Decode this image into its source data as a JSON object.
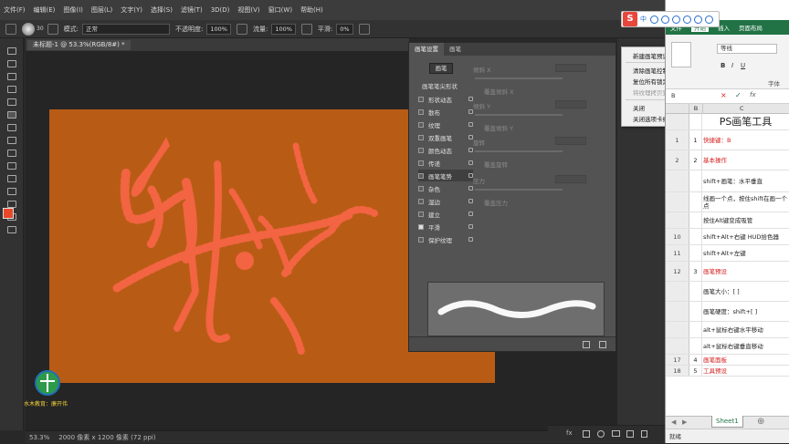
{
  "ps": {
    "menu": [
      "文件(F)",
      "编辑(E)",
      "图像(I)",
      "图层(L)",
      "文字(Y)",
      "选择(S)",
      "滤镜(T)",
      "3D(D)",
      "视图(V)",
      "窗口(W)",
      "帮助(H)"
    ],
    "options": {
      "brush_size": "30",
      "mode_label": "模式:",
      "mode_value": "正常",
      "opacity_label": "不透明度:",
      "opacity_value": "100%",
      "flow_label": "流量:",
      "flow_value": "100%",
      "smooth_label": "平滑:",
      "smooth_value": "0%"
    },
    "doc_tab": "未标题-1 @ 53.3%(RGB/8#) *",
    "status": {
      "zoom": "53.3%",
      "doc_info": "2000 像素 x 1200 像素 (72 ppi)"
    },
    "colors": {
      "canvas": "#b85c15",
      "stroke": "#f26442",
      "foreground": "#e8472a"
    }
  },
  "brush_panel": {
    "tabs": [
      "画笔设置",
      "画笔"
    ],
    "brush_button": "画笔",
    "header": "画笔笔尖形状",
    "options": [
      {
        "label": "形状动态",
        "checked": false
      },
      {
        "label": "散布",
        "checked": false
      },
      {
        "label": "纹理",
        "checked": false
      },
      {
        "label": "双重画笔",
        "checked": false
      },
      {
        "label": "颜色动态",
        "checked": false
      },
      {
        "label": "传递",
        "checked": false
      },
      {
        "label": "画笔笔势",
        "checked": false,
        "selected": true
      },
      {
        "label": "杂色",
        "checked": false
      },
      {
        "label": "湿边",
        "checked": false
      },
      {
        "label": "建立",
        "checked": false
      },
      {
        "label": "平滑",
        "checked": true
      },
      {
        "label": "保护纹理",
        "checked": false
      }
    ],
    "settings": {
      "tilt_x": "倾斜 X",
      "override_tilt_x": "覆盖倾斜 X",
      "tilt_y": "倾斜 Y",
      "override_tilt_y": "覆盖倾斜 Y",
      "rotation": "旋转",
      "override_rotation": "覆盖旋转",
      "pressure": "压力",
      "override_pressure": "覆盖压力"
    }
  },
  "context_menu": {
    "items": [
      {
        "label": "新建画笔预设...",
        "disabled": false
      },
      {
        "label": "清除画笔控制",
        "disabled": false
      },
      {
        "label": "复位所有锁定设置",
        "disabled": false
      },
      {
        "label": "将纹理拷贝到其它工具",
        "disabled": true
      },
      {
        "label": "关闭",
        "disabled": false
      },
      {
        "label": "关闭选项卡组",
        "disabled": false
      }
    ]
  },
  "ime": {
    "logo": "S",
    "lang": "中"
  },
  "excel": {
    "ribbon_tabs": [
      "文件",
      "开始",
      "插入",
      "页面布局"
    ],
    "font_name": "等线",
    "font_group": "字体",
    "formula_cell": "B",
    "col_headers": [
      "B",
      "C"
    ],
    "title": "PS画笔工具",
    "rows": [
      {
        "num": "",
        "b": "",
        "c": "PS画笔工具",
        "red": false,
        "title": true
      },
      {
        "num": "1",
        "b": "1",
        "c": "快捷键：B",
        "red": true
      },
      {
        "num": "2",
        "b": "2",
        "c": "基本操作",
        "red": true
      },
      {
        "num": "",
        "b": "",
        "c": "shift+画笔：水平垂直",
        "red": false
      },
      {
        "num": "",
        "b": "",
        "c": "线画一个点，按住shift在画一个点",
        "red": false
      },
      {
        "num": "",
        "b": "",
        "c": "按住Alt键变成吸管",
        "red": false
      },
      {
        "num": "10",
        "b": "",
        "c": "shift+Alt+右键  HUD拾色器",
        "red": false
      },
      {
        "num": "11",
        "b": "",
        "c": "shift+Alt+左键",
        "red": false
      },
      {
        "num": "12",
        "b": "3",
        "c": "画笔预设",
        "red": true
      },
      {
        "num": "",
        "b": "",
        "c": "画笔大小：[  ]",
        "red": false
      },
      {
        "num": "",
        "b": "",
        "c": "画笔硬度：shift+[  ]",
        "red": false
      },
      {
        "num": "",
        "b": "",
        "c": "alt+鼠标右键水平移动",
        "red": false
      },
      {
        "num": "",
        "b": "",
        "c": "alt+鼠标右键垂直移动",
        "red": false
      },
      {
        "num": "17",
        "b": "4",
        "c": "画笔面板",
        "red": true
      },
      {
        "num": "18",
        "b": "5",
        "c": "工具预设",
        "red": true
      }
    ],
    "sheet_tab": "Sheet1",
    "status": "就绪"
  },
  "watermark": {
    "text": "水木教育：廉开伟"
  }
}
